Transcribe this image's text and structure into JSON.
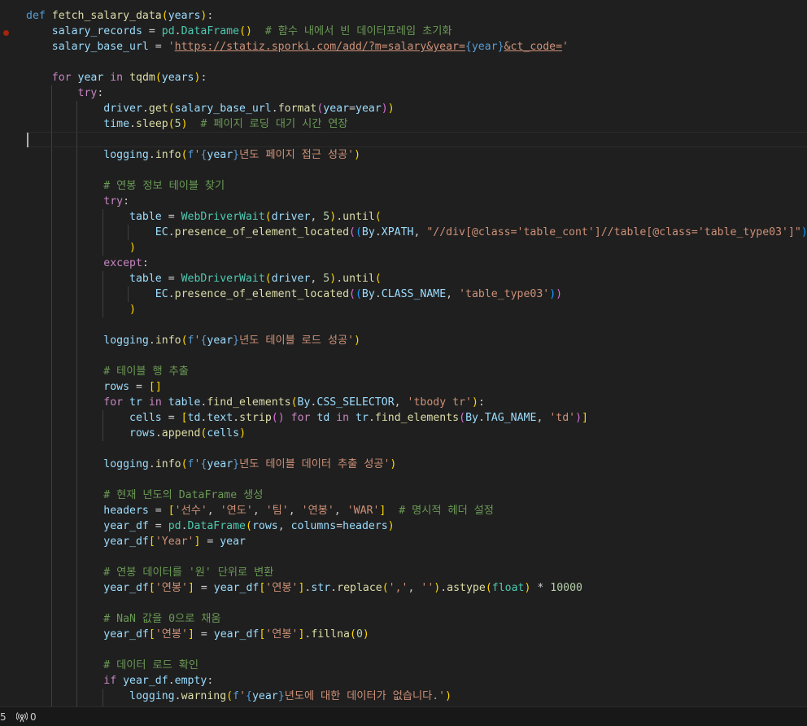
{
  "editor": {
    "lines": [
      [
        [
          "kw",
          "def "
        ],
        [
          "fn",
          "fetch_salary_data"
        ],
        [
          "b1",
          "("
        ],
        [
          "var",
          "years"
        ],
        [
          "b1",
          ")"
        ],
        [
          "plain",
          ":"
        ]
      ],
      [
        [
          "plain",
          "    "
        ],
        [
          "var",
          "salary_records"
        ],
        [
          "plain",
          " = "
        ],
        [
          "cls",
          "pd"
        ],
        [
          "plain",
          "."
        ],
        [
          "cls",
          "DataFrame"
        ],
        [
          "b1",
          "()"
        ],
        [
          "plain",
          "  "
        ],
        [
          "cmt",
          "# 함수 내에서 빈 데이터프레임 초기화"
        ]
      ],
      [
        [
          "plain",
          "    "
        ],
        [
          "var",
          "salary_base_url"
        ],
        [
          "plain",
          " = "
        ],
        [
          "str",
          "'"
        ],
        [
          "url",
          "https://statiz.sporki.com/add/?m=salary&year="
        ],
        [
          "kw",
          "{year}"
        ],
        [
          "url",
          "&ct_code="
        ],
        [
          "str",
          "'"
        ]
      ],
      [],
      [
        [
          "plain",
          "    "
        ],
        [
          "ctl",
          "for "
        ],
        [
          "var",
          "year"
        ],
        [
          "ctl",
          " in "
        ],
        [
          "fn",
          "tqdm"
        ],
        [
          "b1",
          "("
        ],
        [
          "var",
          "years"
        ],
        [
          "b1",
          ")"
        ],
        [
          "plain",
          ":"
        ]
      ],
      [
        [
          "plain",
          "        "
        ],
        [
          "ctl",
          "try"
        ],
        [
          "plain",
          ":"
        ]
      ],
      [
        [
          "plain",
          "            "
        ],
        [
          "var",
          "driver"
        ],
        [
          "plain",
          "."
        ],
        [
          "fn",
          "get"
        ],
        [
          "b1",
          "("
        ],
        [
          "var",
          "salary_base_url"
        ],
        [
          "plain",
          "."
        ],
        [
          "fn",
          "format"
        ],
        [
          "b2",
          "("
        ],
        [
          "var",
          "year"
        ],
        [
          "plain",
          "="
        ],
        [
          "var",
          "year"
        ],
        [
          "b2",
          ")"
        ],
        [
          "b1",
          ")"
        ]
      ],
      [
        [
          "plain",
          "            "
        ],
        [
          "var",
          "time"
        ],
        [
          "plain",
          "."
        ],
        [
          "fn",
          "sleep"
        ],
        [
          "b1",
          "("
        ],
        [
          "num",
          "5"
        ],
        [
          "b1",
          ")"
        ],
        [
          "plain",
          "  "
        ],
        [
          "cmt",
          "# 페이지 로딩 대기 시간 연장"
        ]
      ],
      [],
      [
        [
          "plain",
          "            "
        ],
        [
          "var",
          "logging"
        ],
        [
          "plain",
          "."
        ],
        [
          "fn",
          "info"
        ],
        [
          "b1",
          "("
        ],
        [
          "kw",
          "f"
        ],
        [
          "str",
          "'"
        ],
        [
          "kw",
          "{"
        ],
        [
          "var",
          "year"
        ],
        [
          "kw",
          "}"
        ],
        [
          "str",
          "년도 페이지 접근 성공'"
        ],
        [
          "b1",
          ")"
        ]
      ],
      [],
      [
        [
          "plain",
          "            "
        ],
        [
          "cmt",
          "# 연봉 정보 테이블 찾기"
        ]
      ],
      [
        [
          "plain",
          "            "
        ],
        [
          "ctl",
          "try"
        ],
        [
          "plain",
          ":"
        ]
      ],
      [
        [
          "plain",
          "                "
        ],
        [
          "var",
          "table"
        ],
        [
          "plain",
          " = "
        ],
        [
          "cls",
          "WebDriverWait"
        ],
        [
          "b1",
          "("
        ],
        [
          "var",
          "driver"
        ],
        [
          "plain",
          ", "
        ],
        [
          "num",
          "5"
        ],
        [
          "b1",
          ")"
        ],
        [
          "plain",
          "."
        ],
        [
          "fn",
          "until"
        ],
        [
          "b1",
          "("
        ]
      ],
      [
        [
          "plain",
          "                    "
        ],
        [
          "var",
          "EC"
        ],
        [
          "plain",
          "."
        ],
        [
          "fn",
          "presence_of_element_located"
        ],
        [
          "b2",
          "("
        ],
        [
          "b3",
          "("
        ],
        [
          "var",
          "By"
        ],
        [
          "plain",
          "."
        ],
        [
          "var",
          "XPATH"
        ],
        [
          "plain",
          ", "
        ],
        [
          "str",
          "\"//div[@class='table_cont']//table[@class='table_type03']\""
        ],
        [
          "b3",
          ")"
        ],
        [
          "b2",
          ")"
        ]
      ],
      [
        [
          "plain",
          "                "
        ],
        [
          "b1",
          ")"
        ]
      ],
      [
        [
          "plain",
          "            "
        ],
        [
          "ctl",
          "except"
        ],
        [
          "plain",
          ":"
        ]
      ],
      [
        [
          "plain",
          "                "
        ],
        [
          "var",
          "table"
        ],
        [
          "plain",
          " = "
        ],
        [
          "cls",
          "WebDriverWait"
        ],
        [
          "b1",
          "("
        ],
        [
          "var",
          "driver"
        ],
        [
          "plain",
          ", "
        ],
        [
          "num",
          "5"
        ],
        [
          "b1",
          ")"
        ],
        [
          "plain",
          "."
        ],
        [
          "fn",
          "until"
        ],
        [
          "b1",
          "("
        ]
      ],
      [
        [
          "plain",
          "                    "
        ],
        [
          "var",
          "EC"
        ],
        [
          "plain",
          "."
        ],
        [
          "fn",
          "presence_of_element_located"
        ],
        [
          "b2",
          "("
        ],
        [
          "b3",
          "("
        ],
        [
          "var",
          "By"
        ],
        [
          "plain",
          "."
        ],
        [
          "var",
          "CLASS_NAME"
        ],
        [
          "plain",
          ", "
        ],
        [
          "str",
          "'table_type03'"
        ],
        [
          "b3",
          ")"
        ],
        [
          "b2",
          ")"
        ]
      ],
      [
        [
          "plain",
          "                "
        ],
        [
          "b1",
          ")"
        ]
      ],
      [],
      [
        [
          "plain",
          "            "
        ],
        [
          "var",
          "logging"
        ],
        [
          "plain",
          "."
        ],
        [
          "fn",
          "info"
        ],
        [
          "b1",
          "("
        ],
        [
          "kw",
          "f"
        ],
        [
          "str",
          "'"
        ],
        [
          "kw",
          "{"
        ],
        [
          "var",
          "year"
        ],
        [
          "kw",
          "}"
        ],
        [
          "str",
          "년도 테이블 로드 성공'"
        ],
        [
          "b1",
          ")"
        ]
      ],
      [],
      [
        [
          "plain",
          "            "
        ],
        [
          "cmt",
          "# 테이블 행 추출"
        ]
      ],
      [
        [
          "plain",
          "            "
        ],
        [
          "var",
          "rows"
        ],
        [
          "plain",
          " = "
        ],
        [
          "b1",
          "[]"
        ]
      ],
      [
        [
          "plain",
          "            "
        ],
        [
          "ctl",
          "for "
        ],
        [
          "var",
          "tr"
        ],
        [
          "ctl",
          " in "
        ],
        [
          "var",
          "table"
        ],
        [
          "plain",
          "."
        ],
        [
          "fn",
          "find_elements"
        ],
        [
          "b1",
          "("
        ],
        [
          "var",
          "By"
        ],
        [
          "plain",
          "."
        ],
        [
          "var",
          "CSS_SELECTOR"
        ],
        [
          "plain",
          ", "
        ],
        [
          "str",
          "'tbody tr'"
        ],
        [
          "b1",
          ")"
        ],
        [
          "plain",
          ":"
        ]
      ],
      [
        [
          "plain",
          "                "
        ],
        [
          "var",
          "cells"
        ],
        [
          "plain",
          " = "
        ],
        [
          "b1",
          "["
        ],
        [
          "var",
          "td"
        ],
        [
          "plain",
          "."
        ],
        [
          "var",
          "text"
        ],
        [
          "plain",
          "."
        ],
        [
          "fn",
          "strip"
        ],
        [
          "b2",
          "()"
        ],
        [
          "ctl",
          " for "
        ],
        [
          "var",
          "td"
        ],
        [
          "ctl",
          " in "
        ],
        [
          "var",
          "tr"
        ],
        [
          "plain",
          "."
        ],
        [
          "fn",
          "find_elements"
        ],
        [
          "b2",
          "("
        ],
        [
          "var",
          "By"
        ],
        [
          "plain",
          "."
        ],
        [
          "var",
          "TAG_NAME"
        ],
        [
          "plain",
          ", "
        ],
        [
          "str",
          "'td'"
        ],
        [
          "b2",
          ")"
        ],
        [
          "b1",
          "]"
        ]
      ],
      [
        [
          "plain",
          "                "
        ],
        [
          "var",
          "rows"
        ],
        [
          "plain",
          "."
        ],
        [
          "fn",
          "append"
        ],
        [
          "b1",
          "("
        ],
        [
          "var",
          "cells"
        ],
        [
          "b1",
          ")"
        ]
      ],
      [],
      [
        [
          "plain",
          "            "
        ],
        [
          "var",
          "logging"
        ],
        [
          "plain",
          "."
        ],
        [
          "fn",
          "info"
        ],
        [
          "b1",
          "("
        ],
        [
          "kw",
          "f"
        ],
        [
          "str",
          "'"
        ],
        [
          "kw",
          "{"
        ],
        [
          "var",
          "year"
        ],
        [
          "kw",
          "}"
        ],
        [
          "str",
          "년도 테이블 데이터 추출 성공'"
        ],
        [
          "b1",
          ")"
        ]
      ],
      [],
      [
        [
          "plain",
          "            "
        ],
        [
          "cmt",
          "# 현재 년도의 DataFrame 생성"
        ]
      ],
      [
        [
          "plain",
          "            "
        ],
        [
          "var",
          "headers"
        ],
        [
          "plain",
          " = "
        ],
        [
          "b1",
          "["
        ],
        [
          "str",
          "'선수'"
        ],
        [
          "plain",
          ", "
        ],
        [
          "str",
          "'연도'"
        ],
        [
          "plain",
          ", "
        ],
        [
          "str",
          "'팀'"
        ],
        [
          "plain",
          ", "
        ],
        [
          "str",
          "'연봉'"
        ],
        [
          "plain",
          ", "
        ],
        [
          "str",
          "'WAR'"
        ],
        [
          "b1",
          "]"
        ],
        [
          "plain",
          "  "
        ],
        [
          "cmt",
          "# 명시적 헤더 설정"
        ]
      ],
      [
        [
          "plain",
          "            "
        ],
        [
          "var",
          "year_df"
        ],
        [
          "plain",
          " = "
        ],
        [
          "cls",
          "pd"
        ],
        [
          "plain",
          "."
        ],
        [
          "cls",
          "DataFrame"
        ],
        [
          "b1",
          "("
        ],
        [
          "var",
          "rows"
        ],
        [
          "plain",
          ", "
        ],
        [
          "var",
          "columns"
        ],
        [
          "plain",
          "="
        ],
        [
          "var",
          "headers"
        ],
        [
          "b1",
          ")"
        ]
      ],
      [
        [
          "plain",
          "            "
        ],
        [
          "var",
          "year_df"
        ],
        [
          "b1",
          "["
        ],
        [
          "str",
          "'Year'"
        ],
        [
          "b1",
          "]"
        ],
        [
          "plain",
          " = "
        ],
        [
          "var",
          "year"
        ]
      ],
      [],
      [
        [
          "plain",
          "            "
        ],
        [
          "cmt",
          "# 연봉 데이터를 '원' 단위로 변환"
        ]
      ],
      [
        [
          "plain",
          "            "
        ],
        [
          "var",
          "year_df"
        ],
        [
          "b1",
          "["
        ],
        [
          "str",
          "'연봉'"
        ],
        [
          "b1",
          "]"
        ],
        [
          "plain",
          " = "
        ],
        [
          "var",
          "year_df"
        ],
        [
          "b1",
          "["
        ],
        [
          "str",
          "'연봉'"
        ],
        [
          "b1",
          "]"
        ],
        [
          "plain",
          "."
        ],
        [
          "var",
          "str"
        ],
        [
          "plain",
          "."
        ],
        [
          "fn",
          "replace"
        ],
        [
          "b1",
          "("
        ],
        [
          "str",
          "','"
        ],
        [
          "plain",
          ", "
        ],
        [
          "str",
          "''"
        ],
        [
          "b1",
          ")"
        ],
        [
          "plain",
          "."
        ],
        [
          "fn",
          "astype"
        ],
        [
          "b1",
          "("
        ],
        [
          "cls",
          "float"
        ],
        [
          "b1",
          ")"
        ],
        [
          "plain",
          " * "
        ],
        [
          "num",
          "10000"
        ]
      ],
      [],
      [
        [
          "plain",
          "            "
        ],
        [
          "cmt",
          "# NaN 값을 0으로 채움"
        ]
      ],
      [
        [
          "plain",
          "            "
        ],
        [
          "var",
          "year_df"
        ],
        [
          "b1",
          "["
        ],
        [
          "str",
          "'연봉'"
        ],
        [
          "b1",
          "]"
        ],
        [
          "plain",
          " = "
        ],
        [
          "var",
          "year_df"
        ],
        [
          "b1",
          "["
        ],
        [
          "str",
          "'연봉'"
        ],
        [
          "b1",
          "]"
        ],
        [
          "plain",
          "."
        ],
        [
          "fn",
          "fillna"
        ],
        [
          "b1",
          "("
        ],
        [
          "num",
          "0"
        ],
        [
          "b1",
          ")"
        ]
      ],
      [],
      [
        [
          "plain",
          "            "
        ],
        [
          "cmt",
          "# 데이터 로드 확인"
        ]
      ],
      [
        [
          "plain",
          "            "
        ],
        [
          "ctl",
          "if "
        ],
        [
          "var",
          "year_df"
        ],
        [
          "plain",
          "."
        ],
        [
          "var",
          "empty"
        ],
        [
          "plain",
          ":"
        ]
      ],
      [
        [
          "plain",
          "                "
        ],
        [
          "var",
          "logging"
        ],
        [
          "plain",
          "."
        ],
        [
          "fn",
          "warning"
        ],
        [
          "b1",
          "("
        ],
        [
          "kw",
          "f"
        ],
        [
          "str",
          "'"
        ],
        [
          "kw",
          "{"
        ],
        [
          "var",
          "year"
        ],
        [
          "kw",
          "}"
        ],
        [
          "str",
          "년도에 대한 데이터가 없습니다.'"
        ],
        [
          "b1",
          ")"
        ]
      ]
    ]
  },
  "statusbar": {
    "left_fragment": "5",
    "ports_count": "0"
  }
}
